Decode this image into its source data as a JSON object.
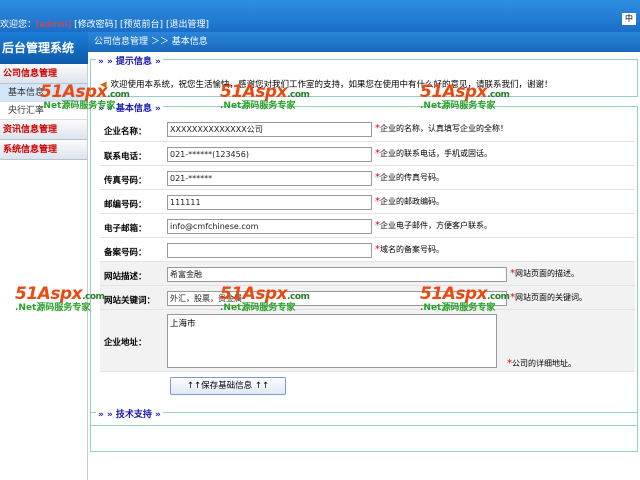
{
  "header": {
    "links_prefix": "欢迎您：",
    "admin": "[admin]",
    "change_password": "[修改密码]",
    "preview": "[预览前台]",
    "logout": "[退出管理]",
    "corner": "中",
    "logo": "后台管理系统",
    "breadcrumb": "公司信息管理 ＞＞ 基本信息"
  },
  "sidebar": {
    "sections": [
      {
        "label": "公司信息管理",
        "items": [
          {
            "label": "基本信息"
          },
          {
            "label": "央行汇率"
          }
        ]
      },
      {
        "label": "资讯信息管理",
        "items": []
      },
      {
        "label": "系统信息管理",
        "items": []
      }
    ]
  },
  "notice": {
    "legend": "提示信息",
    "text": "欢迎使用本系统，祝您生活愉快，感谢您对我们工作室的支持，如果您在使用中有什么好的意见，请联系我们，谢谢！"
  },
  "form": {
    "legend": "基本信息",
    "fields": [
      {
        "label": "企业名称：",
        "value": "XXXXXXXXXXXXXX公司",
        "hint": "企业的名称，认真填写企业的全称！"
      },
      {
        "label": "联系电话：",
        "value": "021-******(123456)",
        "hint": "企业的联系电话，手机或固话。"
      },
      {
        "label": "传真号码：",
        "value": "021-******",
        "hint": "企业的传真号码。"
      },
      {
        "label": "邮编号码：",
        "value": "111111",
        "hint": "企业的邮政编码。"
      },
      {
        "label": "电子邮箱：",
        "value": "info@cmfchinese.com",
        "hint": "企业电子邮件，方便客户联系。"
      },
      {
        "label": "备案号码：",
        "value": "",
        "hint": "域名的备案号码。"
      },
      {
        "label": "网站描述：",
        "value": "希富金融",
        "hint": "网站页面的描述。"
      },
      {
        "label": "网站关键词：",
        "value": "外汇，股票，贵金属",
        "hint": "网站页面的关键词。"
      },
      {
        "label": "企业地址：",
        "value": "上海市",
        "hint": "公司的详细地址。"
      }
    ],
    "save_label": "↑↑保存基础信息 ↑↑"
  },
  "tech": {
    "legend": "技术支持"
  },
  "watermark": {
    "brand": "51Aspx",
    "suffix": ".com",
    "sub": ".Net源码服务专家"
  }
}
